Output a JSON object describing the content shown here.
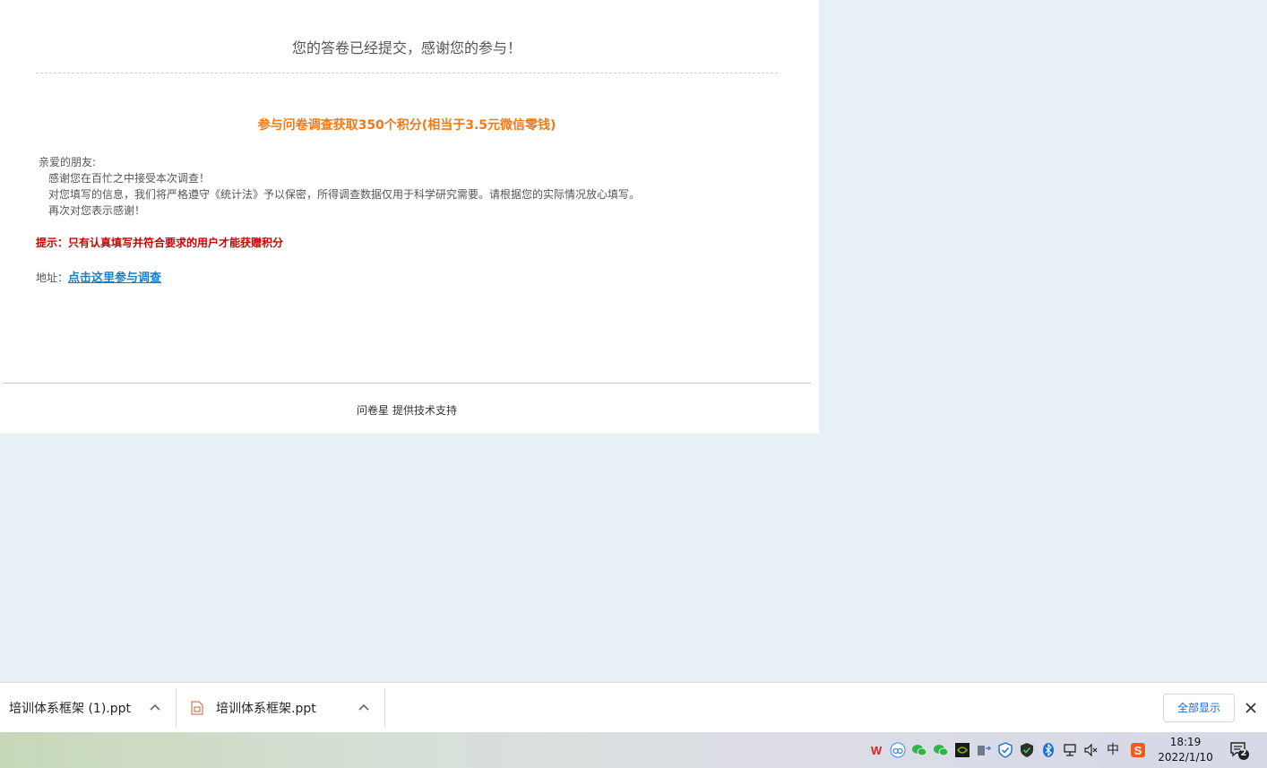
{
  "survey": {
    "thanks_message": "您的答卷已经提交，感谢您的参与！",
    "promo": "参与问卷调查获取350个积分(相当于3.5元微信零钱)",
    "letter": {
      "greeting": "亲爱的朋友:",
      "line1": "感谢您在百忙之中接受本次调查！",
      "line2": "对您填写的信息，我们将严格遵守《统计法》予以保密，所得调查数据仅用于科学研究需要。请根据您的实际情况放心填写。",
      "line3": "再次对您表示感谢！"
    },
    "hint": "提示：只有认真填写并符合要求的用户才能获赠积分",
    "address_label": "地址：",
    "address_link": "点击这里参与调查",
    "footer_brand": "问卷星",
    "footer_text": "提供技术支持"
  },
  "downloads": {
    "items": [
      {
        "name": "培训体系框架 (1).ppt"
      },
      {
        "name": "培训体系框架.ppt"
      }
    ],
    "show_all": "全部显示"
  },
  "taskbar": {
    "time": "18:19",
    "date": "2022/1/10",
    "notification_count": "2",
    "ime": "中"
  },
  "colors": {
    "promo": "#f07a1a",
    "hint": "#d40000",
    "link": "#1a7fc4",
    "background": "#e8f0f7"
  }
}
